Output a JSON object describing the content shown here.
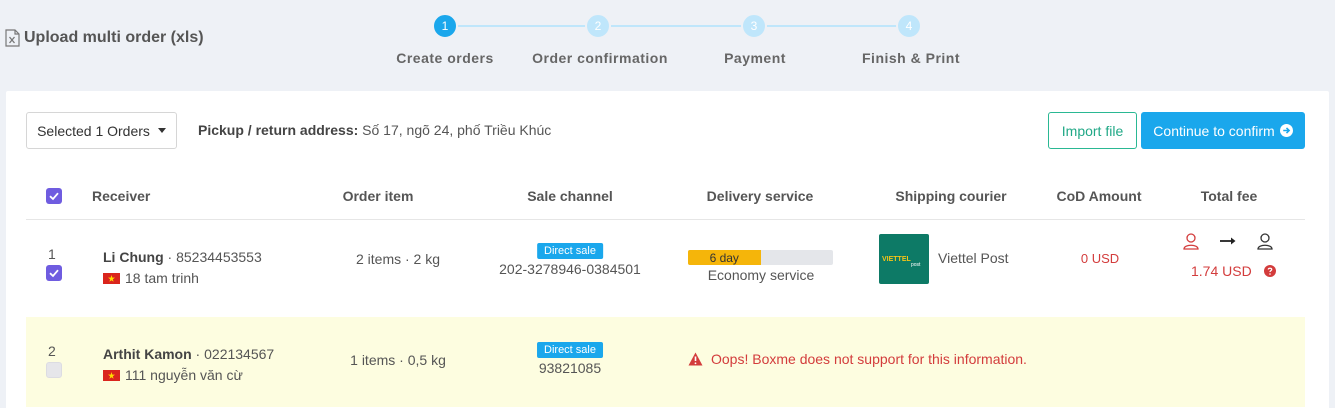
{
  "header": {
    "title": "Upload multi order (xls)",
    "icon": "excel-file-icon"
  },
  "stepper": {
    "steps": [
      {
        "number": "1",
        "label": "Create orders",
        "active": true
      },
      {
        "number": "2",
        "label": "Order confirmation",
        "active": false
      },
      {
        "number": "3",
        "label": "Payment",
        "active": false
      },
      {
        "number": "4",
        "label": "Finish & Print",
        "active": false
      }
    ]
  },
  "toolbar": {
    "selected_label": "Selected 1 Orders",
    "pickup_label": "Pickup / return address:",
    "pickup_value": "Số 17, ngõ 24, phố Triều Khúc",
    "import_label": "Import file",
    "continue_label": "Continue to confirm"
  },
  "table": {
    "columns": [
      "Receiver",
      "Order item",
      "Sale channel",
      "Delivery service",
      "Shipping courier",
      "CoD Amount",
      "Total fee"
    ],
    "rows": [
      {
        "index": "1",
        "checked": true,
        "name": "Li Chung",
        "phone": "85234453553",
        "address": "18 tam trinh",
        "items": "2 items · 2 kg",
        "channel_badge": "Direct sale",
        "channel_code": "202-3278946-0384501",
        "delivery_days": "6 day",
        "delivery_progress_pct": 50,
        "delivery_service": "Economy service",
        "courier": "Viettel Post",
        "cod": "0 USD",
        "total_fee": "1.74 USD"
      },
      {
        "index": "2",
        "checked": false,
        "name": "Arthit Kamon",
        "phone": "022134567",
        "address": "111 nguyễn văn cừ",
        "items": "1 items · 0,5 kg",
        "channel_badge": "Direct sale",
        "channel_code": "93821085",
        "error": "Oops! Boxme does not support for this information."
      }
    ]
  },
  "colors": {
    "primary": "#1aa7ec",
    "success_outline": "#2ab893",
    "checkbox": "#6f5ce0",
    "error": "#d33c3c",
    "warning_bar": "#f5b50a",
    "row_highlight": "#fdfde0"
  }
}
